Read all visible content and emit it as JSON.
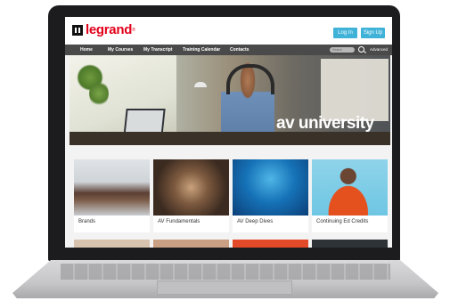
{
  "brand": {
    "name": "legrand",
    "registered": "®",
    "color": "#e2001a"
  },
  "header": {
    "login_label": "Log In",
    "signup_label": "Sign Up",
    "button_color": "#3fb2d8"
  },
  "nav": {
    "items": [
      "Home",
      "My Courses",
      "My Transcript",
      "Training Calendar",
      "Contacts"
    ],
    "search_placeholder": "Search",
    "advanced_label": "Advanced"
  },
  "hero": {
    "title": "av university"
  },
  "cards": [
    {
      "label": "Brands",
      "icon": "conference-room-image"
    },
    {
      "label": "AV Fundamentals",
      "icon": "network-hands-image"
    },
    {
      "label": "AV Deep Dives",
      "icon": "swimmers-image"
    },
    {
      "label": "Continuing Ed Credits",
      "icon": "excited-person-image"
    }
  ]
}
